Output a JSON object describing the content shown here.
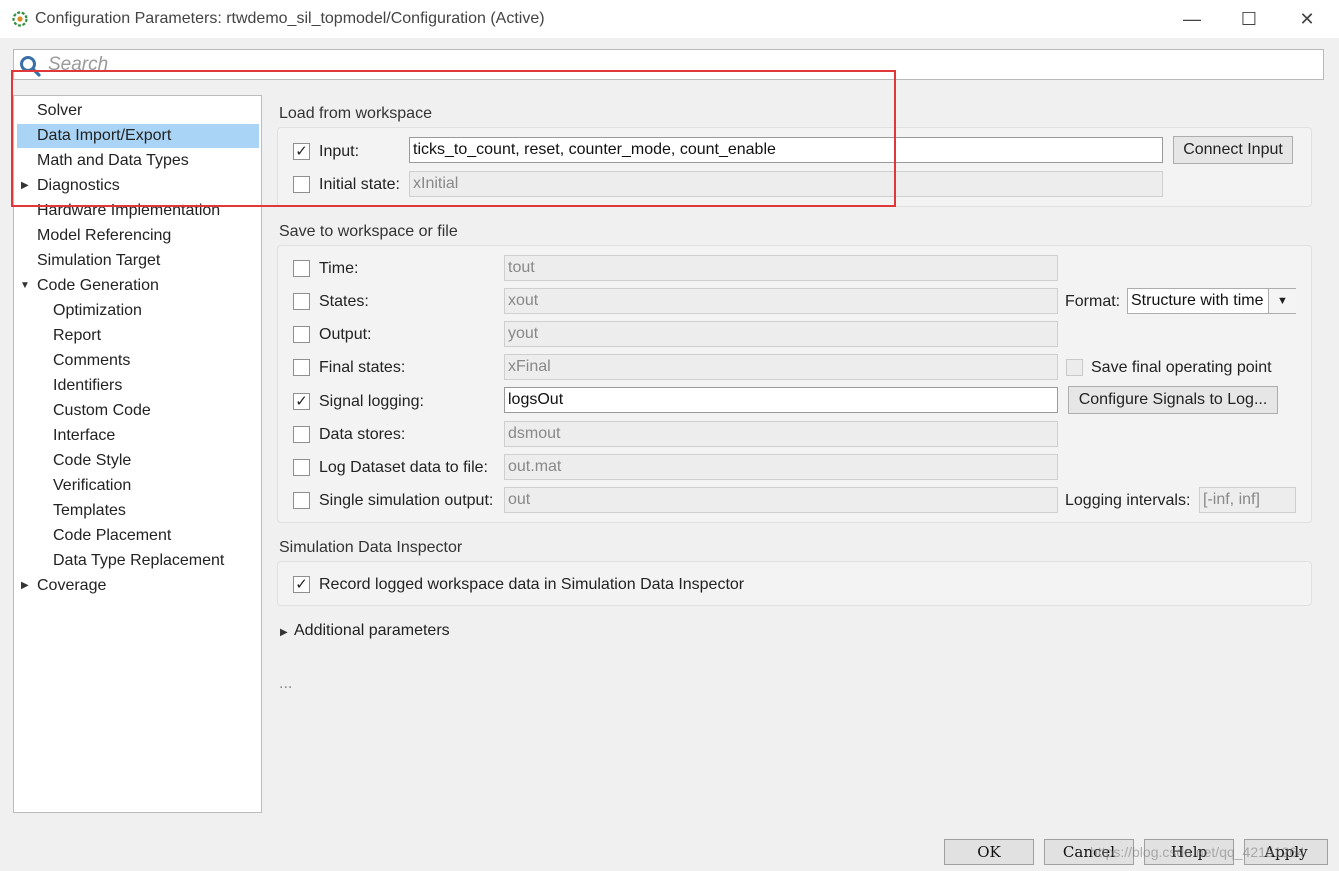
{
  "window": {
    "title": "Configuration Parameters: rtwdemo_sil_topmodel/Configuration (Active)",
    "controls": {
      "minimize": "—",
      "maximize": "☐",
      "close": "✕"
    }
  },
  "search": {
    "placeholder": "Search"
  },
  "tree": {
    "items": [
      {
        "label": "Solver"
      },
      {
        "label": "Data Import/Export",
        "selected": true
      },
      {
        "label": "Math and Data Types"
      },
      {
        "label": "Diagnostics",
        "expander": "collapsed"
      },
      {
        "label": "Hardware Implementation"
      },
      {
        "label": "Model Referencing"
      },
      {
        "label": "Simulation Target"
      },
      {
        "label": "Code Generation",
        "expander": "expanded"
      },
      {
        "label": "Optimization"
      },
      {
        "label": "Report"
      },
      {
        "label": "Comments"
      },
      {
        "label": "Identifiers"
      },
      {
        "label": "Custom Code"
      },
      {
        "label": "Interface"
      },
      {
        "label": "Code Style"
      },
      {
        "label": "Verification"
      },
      {
        "label": "Templates"
      },
      {
        "label": "Code Placement"
      },
      {
        "label": "Data Type Replacement"
      },
      {
        "label": "Coverage",
        "expander": "collapsed"
      }
    ]
  },
  "load": {
    "title": "Load from workspace",
    "input": {
      "label": "Input:",
      "checked": true,
      "value": "ticks_to_count, reset, counter_mode, count_enable",
      "button": "Connect Input"
    },
    "initial_state": {
      "label": "Initial state:",
      "checked": false,
      "value": "xInitial"
    }
  },
  "save": {
    "title": "Save to workspace or file",
    "rows": [
      {
        "label": "Time:",
        "checked": false,
        "value": "tout"
      },
      {
        "label": "States:",
        "checked": false,
        "value": "xout"
      },
      {
        "label": "Output:",
        "checked": false,
        "value": "yout"
      },
      {
        "label": "Final states:",
        "checked": false,
        "value": "xFinal"
      },
      {
        "label": "Signal logging:",
        "checked": true,
        "value": "logsOut"
      },
      {
        "label": "Data stores:",
        "checked": false,
        "value": "dsmout"
      },
      {
        "label": "Log Dataset data to file:",
        "checked": false,
        "value": "out.mat"
      },
      {
        "label": "Single simulation output:",
        "checked": false,
        "value": "out"
      }
    ],
    "format_label": "Format:",
    "format_value": "Structure with time",
    "save_final_op": {
      "label": "Save final operating point",
      "checked": false
    },
    "configure_button": "Configure Signals to Log...",
    "logging_intervals_label": "Logging intervals:",
    "logging_intervals_value": "[-inf, inf]"
  },
  "sdi": {
    "title": "Simulation Data Inspector",
    "record": {
      "label": "Record logged workspace data in Simulation Data Inspector",
      "checked": true
    }
  },
  "additional": {
    "label": "Additional parameters"
  },
  "ellipsis": "...",
  "buttons": {
    "ok": "OK",
    "cancel": "Cancel",
    "help": "Help",
    "apply": "Apply"
  },
  "watermark": "https://blog.csdn.net/qq_42151264",
  "colors": {
    "selection": "#a9d4f5",
    "highlight_box": "#e0373a"
  }
}
